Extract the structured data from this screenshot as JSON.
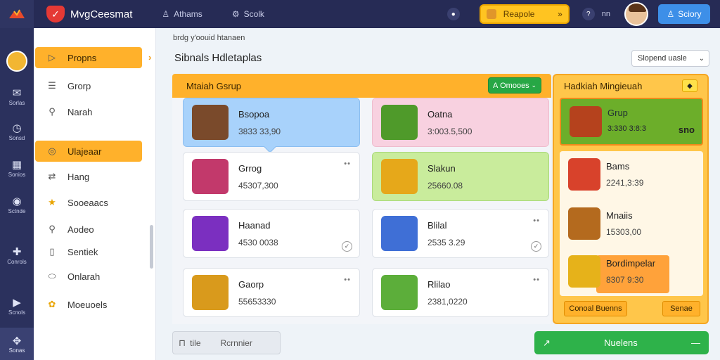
{
  "topbar": {
    "app_title": "MvgCeesmat",
    "links": [
      {
        "label": "Athams",
        "icon": "person-icon"
      },
      {
        "label": "Scolk",
        "icon": "gear-icon"
      }
    ],
    "search_label": "Reapole",
    "search_chevron": "»",
    "lang": "nn",
    "signin_label": "Sciory",
    "accent": "#ffc421"
  },
  "rail": {
    "items": [
      {
        "label": "Sorlas",
        "icon": "mail-icon"
      },
      {
        "label": "Sonsd",
        "icon": "clock-icon"
      },
      {
        "label": "Sonios",
        "icon": "calendar-icon"
      },
      {
        "label": "Sctnde",
        "icon": "settings-icon"
      },
      {
        "label": "Conrols",
        "icon": "puzzle-icon"
      },
      {
        "label": "Scnols",
        "icon": "play-icon"
      },
      {
        "label": "Sonas",
        "icon": "gamepad-icon"
      }
    ]
  },
  "sidebar": {
    "items": [
      {
        "label": "Propns",
        "icon": "play-square-icon",
        "active": true
      },
      {
        "label": "Grorp",
        "icon": "list-icon",
        "active": false
      },
      {
        "label": "Narah",
        "icon": "search-icon",
        "active": false
      },
      {
        "label": "Ulajeaar",
        "icon": "coin-icon",
        "active": true
      },
      {
        "label": "Hang",
        "icon": "swap-icon",
        "active": false
      },
      {
        "label": "Sooeaacs",
        "icon": "star-icon",
        "active": false
      },
      {
        "label": "Aodeo",
        "icon": "search-icon",
        "active": false
      },
      {
        "label": "Sentiek",
        "icon": "document-icon",
        "active": false
      },
      {
        "label": "Onlarah",
        "icon": "oval-icon",
        "active": false
      },
      {
        "label": "Moeuoels",
        "icon": "gift-icon",
        "active": false
      }
    ]
  },
  "main": {
    "breadcrumb": "brdg y'oouid htanaen",
    "title": "Sibnals Hdletaplas",
    "sort_label": "Slopend uasle",
    "group": {
      "title": "Mtaiah Gsrup",
      "add_label": "Omooes",
      "add_prefix": "A",
      "cards": [
        {
          "name": "Bsopoa",
          "value": "3833 33,90",
          "style": "blue",
          "thumb": "#7a4a2b",
          "check": false
        },
        {
          "name": "Oatna",
          "value": "3:003.5,500",
          "style": "pink",
          "thumb": "#4f9a2a",
          "check": false
        },
        {
          "name": "Grrog",
          "value": "45307,300",
          "style": "white",
          "thumb": "#c2396b",
          "check": false
        },
        {
          "name": "Slakun",
          "value": "25660.08",
          "style": "green",
          "thumb": "#e6a81a",
          "check": false
        },
        {
          "name": "Haanad",
          "value": "4530 0038",
          "style": "white",
          "thumb": "#7b2fc0",
          "check": true
        },
        {
          "name": "Blilal",
          "value": "2535 3.29",
          "style": "white",
          "thumb": "#3f6fd6",
          "check": true
        },
        {
          "name": "Gaorp",
          "value": "55653330",
          "style": "white",
          "thumb": "#d99a1c",
          "check": false
        },
        {
          "name": "Rlilao",
          "value": "2381,0220",
          "style": "white",
          "thumb": "#5cae3a",
          "check": false
        }
      ]
    }
  },
  "right_panel": {
    "title": "Hadkiah Mingieuah",
    "featured": {
      "name": "Grup",
      "value": "3:330 3:8:3",
      "badge": "sno"
    },
    "items": [
      {
        "name": "Bams",
        "value": "2241,3:39",
        "thumb": "#d8422b"
      },
      {
        "name": "Mnaiis",
        "value": "15303,00",
        "thumb": "#b46a1e"
      },
      {
        "name": "Bordimpelar",
        "value": "8307 9:30",
        "thumb": "#e6b21a"
      }
    ],
    "btn_left": "Conoal Buenns",
    "btn_right": "Senae"
  },
  "bottom": {
    "left_label": "tile",
    "left_label2": "Rcrnnier",
    "primary_label": "Nuelens",
    "primary_icon": "link-icon",
    "primary_suffix": "—"
  }
}
